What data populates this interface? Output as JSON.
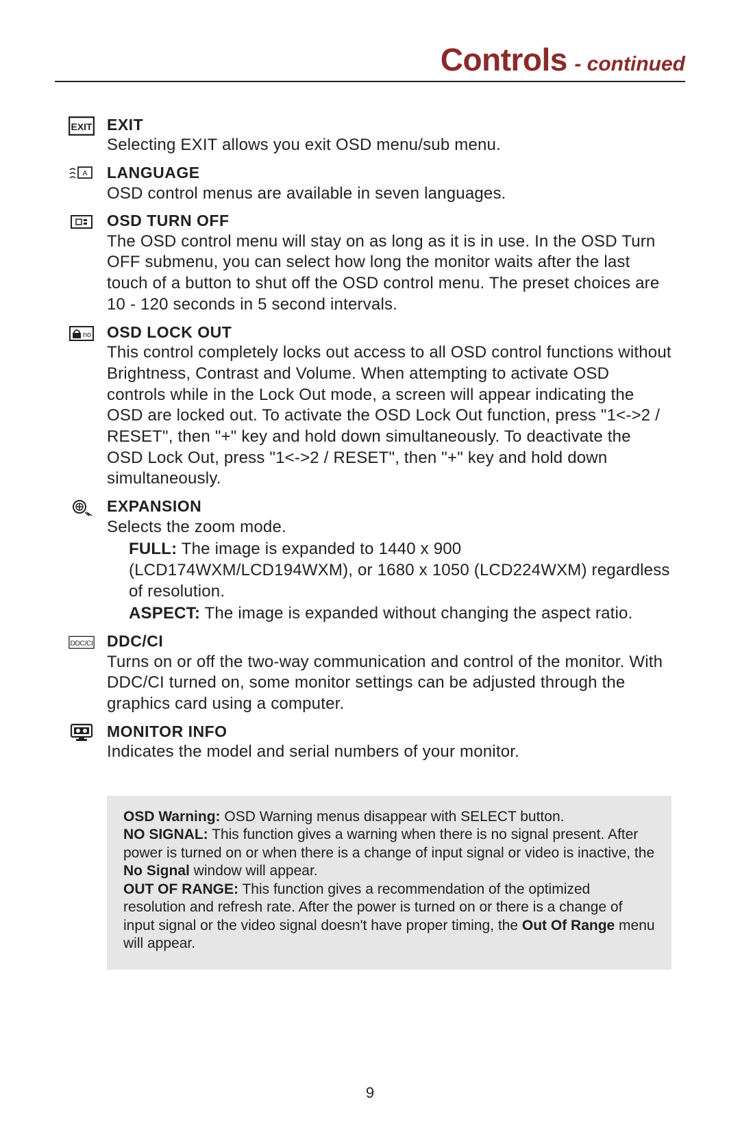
{
  "header": {
    "title": "Controls",
    "subtitle": "- continued"
  },
  "entries": [
    {
      "title": "EXIT",
      "body": "Selecting EXIT allows you exit OSD menu/sub menu."
    },
    {
      "title": "LANGUAGE",
      "body": "OSD control menus are available in seven languages."
    },
    {
      "title": "OSD TURN OFF",
      "body": "The OSD control menu will stay on as long as it is in use. In the OSD Turn OFF submenu, you can select how long the monitor waits after the last touch of a button to shut off the OSD control menu. The preset choices are 10 - 120 seconds in 5 second intervals."
    },
    {
      "title": "OSD LOCK OUT",
      "body": "This control completely locks out access to all OSD control functions without Brightness, Contrast and Volume. When attempting to activate OSD controls while in the Lock Out mode, a screen will appear indicating the OSD are locked out. To activate the OSD Lock Out function, press \"1<->2 / RESET\", then \"+\" key and hold down simultaneously. To deactivate the OSD Lock Out, press \"1<->2 / RESET\", then \"+\" key and hold down simultaneously."
    },
    {
      "title": "EXPANSION",
      "body": "Selects the zoom mode.",
      "sub": [
        {
          "label": "FULL:",
          "text": " The image is expanded to 1440 x 900 (LCD174WXM/LCD194WXM), or 1680 x 1050 (LCD224WXM) regardless of resolution."
        },
        {
          "label": "ASPECT:",
          "text": " The image is expanded without changing the aspect ratio."
        }
      ]
    },
    {
      "title": "DDC/CI",
      "body": "Turns on or off the two-way communication and control of the monitor. With DDC/CI turned on, some monitor settings can be adjusted through the graphics card using a computer."
    },
    {
      "title": "MONITOR INFO",
      "body": "Indicates the model and serial numbers of your monitor."
    }
  ],
  "warning": {
    "lead_label": "OSD Warning:",
    "lead_text": " OSD Warning menus disappear with SELECT button.",
    "no_signal_label": "NO SIGNAL:",
    "no_signal_text_a": " This function gives a warning when there is no signal present. After power is turned on or when there is a change of input signal or video is inactive, the ",
    "no_signal_bold": "No Signal",
    "no_signal_text_b": " window will appear.",
    "oor_label": "OUT OF RANGE:",
    "oor_text_a": " This function gives a recommendation of the optimized resolution and refresh rate. After the power is turned on or there is a change of input signal or the video signal doesn't have proper timing, the ",
    "oor_bold": "Out Of Range",
    "oor_text_b": " menu will appear."
  },
  "page_number": "9"
}
